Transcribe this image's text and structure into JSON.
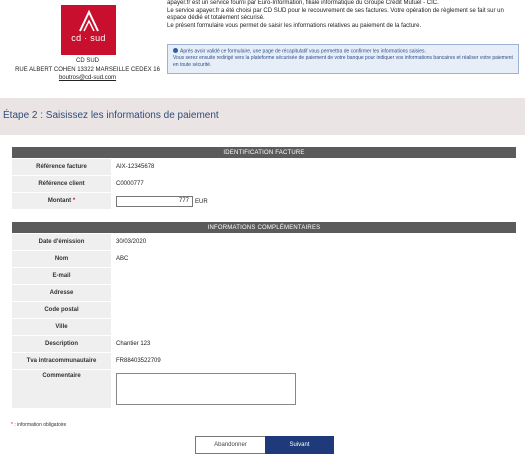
{
  "colors": {
    "brand": "#c8102e",
    "section_header": "#5b5b5b",
    "step_band": "#eae4e4",
    "submit_button": "#1f3a7a"
  },
  "merchant": {
    "logo_text": "cd · sud",
    "name": "CD SUD",
    "address": "RUE ALBERT COHEN 13322 MARSEILLE CEDEX 16",
    "email": "boutros@cd-sud.com"
  },
  "intro": {
    "line1": "apayer.fr est un service fourni par Euro-Information, filiale informatique du Groupe Crédit Mutuel - CIC.",
    "line2": "Le service apayer.fr a été choisi par CD SUD pour le recouvrement de ses factures. Votre opération de règlement se fait sur un espace dédié et totalement sécurisé.",
    "line3": "Le présent formulaire vous permet de saisir les informations relatives au paiement de la facture."
  },
  "info_box": {
    "icon": "info-icon",
    "line1": "Après avoir validé ce formulaire, une page de récapitulatif vous permettra de confirmer les informations saisies.",
    "line2": "Vous serez ensuite redirigé vers la plateforme sécurisée de paiement de votre banque pour indiquer vos informations bancaires et réaliser votre paiement en toute sécurité."
  },
  "step_title": "Étape 2 : Saisissez les informations de paiement",
  "invoice_section": {
    "title": "IDENTIFICATION FACTURE",
    "reference_label": "Référence facture",
    "reference_value": "AIX-12345678",
    "client_label": "Référence client",
    "client_value": "C0000777",
    "amount_label": "Montant",
    "amount_required": "*",
    "amount_value": "777",
    "currency": "EUR"
  },
  "extra_section": {
    "title": "INFORMATIONS COMPLÉMENTAIRES",
    "date_label": "Date d'émission",
    "date_value": "30/03/2020",
    "name_label": "Nom",
    "name_value": "ABC",
    "email_label": "E-mail",
    "address_label": "Adresse",
    "postal_label": "Code postal",
    "city_label": "Ville",
    "description_label": "Description",
    "description_value": "Chantier 123",
    "vat_label": "Tva intracommunautaire",
    "vat_value": "FR88403522709",
    "comment_label": "Commentaire"
  },
  "required_note_star": "*",
  "required_note": " : information obligatoire",
  "buttons": {
    "cancel": "Abandonner",
    "submit": "Suivant"
  }
}
